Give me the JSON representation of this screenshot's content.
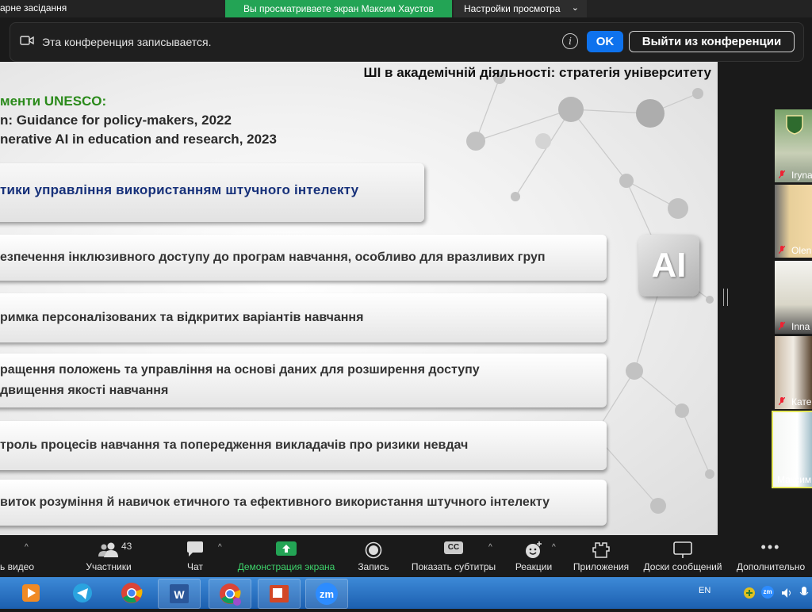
{
  "window": {
    "title": "арне засідання",
    "share_banner": "Вы просматриваете экран Максим Хаустов",
    "view_options": "Настройки просмотра"
  },
  "recording": {
    "text": "Эта конференция записывается.",
    "ok": "OK",
    "leave": "Выйти из конференции"
  },
  "slide": {
    "title": "ШІ в академічній діяльності: стратегія університету",
    "unesco_heading": "менти UNESCO:",
    "refs": [
      "n: Guidance for policy-makers, 2022",
      "nerative AI in education and research, 2023"
    ],
    "section_heading": "тики управління використанням штучного інтелекту",
    "items": [
      {
        "text": "езпечення інклюзивного доступу до програм навчання, особливо для вразливих груп"
      },
      {
        "text": "римка персоналізованих та відкритих варіантів навчання"
      },
      {
        "text": "ращення положень та управління на основі даних для розширення доступу",
        "text2": "двищення якості навчання"
      },
      {
        "text": "троль процесів навчання та попередження викладачів про ризики невдач"
      },
      {
        "text": "виток розуміння й навичок етичного та ефективного використання штучного інтелекту"
      }
    ],
    "ai_badge": "AI"
  },
  "participants": [
    {
      "name": "Iryna",
      "muted": true
    },
    {
      "name": "Olen",
      "muted": true
    },
    {
      "name": "Inna",
      "muted": true
    },
    {
      "name": "Кате",
      "muted": true
    },
    {
      "name": "Максим",
      "muted": false,
      "active": true
    }
  ],
  "toolbar": {
    "video": "ь видео",
    "participants": "Участники",
    "participants_count": "43",
    "chat": "Чат",
    "share": "Демонстрация экрана",
    "record": "Запись",
    "captions": "Показать субтитры",
    "captions_badge": "CC",
    "reactions": "Реакции",
    "apps": "Приложения",
    "whiteboards": "Доски сообщений",
    "more": "Дополнительно"
  },
  "taskbar": {
    "lang": "EN",
    "zm_label": "zm",
    "icons": [
      "media-player-icon",
      "telegram-icon",
      "chrome-icon",
      "word-icon",
      "chrome-profile-icon",
      "powerpoint-icon",
      "zoom-icon"
    ]
  },
  "colors": {
    "share_green": "#23a455",
    "ok_blue": "#0e72ed",
    "heading_navy": "#17317a",
    "unesco_green": "#2a8a1a"
  }
}
